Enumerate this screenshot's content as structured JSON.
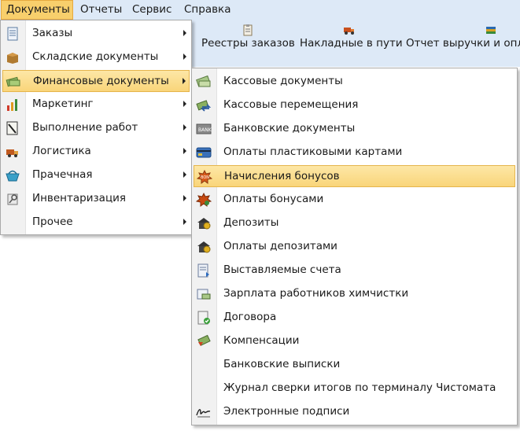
{
  "menubar": {
    "items": [
      {
        "label": "Документы",
        "active": true
      },
      {
        "label": "Отчеты"
      },
      {
        "label": "Сервис"
      },
      {
        "label": "Справка"
      }
    ]
  },
  "toolbar": {
    "buttons": [
      {
        "label": "Реестры заказов",
        "icon": "clipboard-icon"
      },
      {
        "label": "Накладные в пути",
        "icon": "truck-icon"
      },
      {
        "label": "Отчет выручки и опл",
        "icon": "books-icon"
      }
    ]
  },
  "documents_menu": {
    "items": [
      {
        "label": "Заказы",
        "icon": "orders-icon",
        "has_submenu": true
      },
      {
        "label": "Складские документы",
        "icon": "box-icon",
        "has_submenu": true
      },
      {
        "label": "Финансовые документы",
        "icon": "money-icon",
        "has_submenu": true,
        "highlighted": true
      },
      {
        "label": "Маркетинг",
        "icon": "chart-icon",
        "has_submenu": true
      },
      {
        "label": "Выполнение работ",
        "icon": "checklist-icon",
        "has_submenu": true
      },
      {
        "label": "Логистика",
        "icon": "truck-icon",
        "has_submenu": true
      },
      {
        "label": "Прачечная",
        "icon": "basket-icon",
        "has_submenu": true
      },
      {
        "label": "Инвентаризация",
        "icon": "inventory-icon",
        "has_submenu": true
      },
      {
        "label": "Прочее",
        "icon": "",
        "has_submenu": true
      }
    ]
  },
  "finance_submenu": {
    "items": [
      {
        "label": "Кассовые документы",
        "icon": "cash-icon"
      },
      {
        "label": "Кассовые перемещения",
        "icon": "cash-transfer-icon"
      },
      {
        "label": "Банковские документы",
        "icon": "bank-icon"
      },
      {
        "label": "Оплаты пластиковыми картами",
        "icon": "credit-card-icon"
      },
      {
        "label": "Начисления бонусов",
        "icon": "bonus-icon",
        "highlighted": true
      },
      {
        "label": "Оплаты бонусами",
        "icon": "bonus-payment-icon"
      },
      {
        "label": "Депозиты",
        "icon": "deposit-icon"
      },
      {
        "label": "Оплаты депозитами",
        "icon": "deposit-payment-icon"
      },
      {
        "label": "Выставляемые счета",
        "icon": "invoice-icon"
      },
      {
        "label": "Зарплата работников химчистки",
        "icon": "salary-icon"
      },
      {
        "label": "Договора",
        "icon": "contract-icon"
      },
      {
        "label": "Компенсации",
        "icon": "compensation-icon"
      },
      {
        "label": "Банковские выписки",
        "icon": ""
      },
      {
        "label": "Журнал сверки итогов по терминалу Чистомата",
        "icon": ""
      },
      {
        "label": "Электронные подписи",
        "icon": "signature-icon"
      }
    ]
  },
  "colors": {
    "menubar_bg": "#dde9f7",
    "highlight": "#f9d57a",
    "highlight_border": "#e5b54c"
  }
}
